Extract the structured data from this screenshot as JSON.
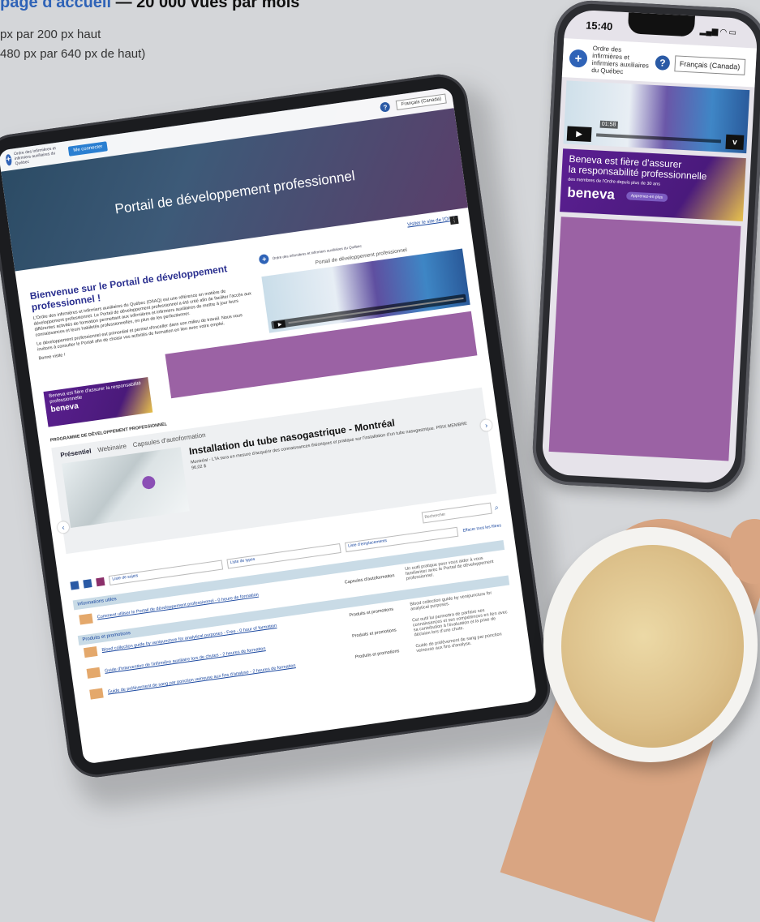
{
  "headline": {
    "part1": "page d'accueil",
    "part2": " — 20 000 vues par mois"
  },
  "specs": [
    "px par 200 px haut",
    "480 px par 640 px de haut)"
  ],
  "tablet": {
    "login_button": "Me connecter",
    "logo_text": "Ordre des infirmières et infirmiers auxiliaires du Québec",
    "language": "Français (Canada)",
    "hero_title": "Portail de développement professionnel",
    "site_link": "Visiter le site de l'OIIAQ",
    "welcome_title": "Bienvenue sur le Portail de développement professionnel !",
    "welcome_p1": "L'Ordre des infirmières et infirmiers auxiliaires du Québec (OIIAQ) est une référence en matière de développement professionnel. Le Portail de développement professionnel a été créé afin de faciliter l'accès aux différentes activités de formation permettant aux infirmières et infirmiers auxiliaires de mettre à jour leurs connaissances et leurs habiletés professionnelles, en plus de les perfectionner.",
    "welcome_p2": "Le développement professionnel est primordial et permet d'exceller dans son milieu de travail. Nous vous invitons à consulter le Portail afin de choisir vos activités de formation en lien avec votre emploi.",
    "welcome_p3": "Bonne visite !",
    "portal_sub": "Portail de développement professionnel",
    "beneva_text": "Beneva est fière d'assurer la responsabilité professionnelle",
    "beneva_sub": "des membres de l'Ordre depuis plus de 30 ans",
    "beneva_brand": "beneva",
    "program_title": "PROGRAMME DE DÉVELOPPEMENT PROFESSIONNEL",
    "tabs": [
      "Présentiel",
      "Webinaire",
      "Capsules d'autoformation"
    ],
    "card_title": "Installation du tube nasogastrique - Montréal",
    "card_desc": "Montréal - L'IA sera en mesure d'acquérir des connaissances théoriques et pratique sur l'installation d'un tube nasogastrique. PRIX MEMBRE 96,02 $",
    "search_placeholder": "Rechercher",
    "filters": [
      "Liste de sujets",
      "Liste de types",
      "Liste d'emplacements"
    ],
    "clear_filters": "Effacer tous les filtres",
    "groups": [
      {
        "label": "Informations utiles",
        "items": [
          {
            "title": "Comment utiliser le Portail de développement professionnel - 0 heure de formation",
            "kind": "Capsules d'autoformation",
            "desc": "Un outil pratique pour vous aider à vous familiariser avec le Portail de développement professionnel."
          }
        ]
      },
      {
        "label": "Produits et promotions",
        "items": [
          {
            "title": "Blood collection guide by venipuncture for analytical purposes - Free - 0 hour of formation",
            "kind": "Produits et promotions",
            "desc": "Blood collection guide by venipuncture for analytical purposes."
          },
          {
            "title": "Guide d'intervention de l'infirmière auxiliaire lors de chutes - 2 heures de formation",
            "kind": "Produits et promotions",
            "desc": "Cet outil lui permettra de parfaire ses connaissances et ses compétences en lien avec sa contribution à l'évaluation et la prise de décision lors d'une chute."
          },
          {
            "title": "Guide de prélèvement de sang par ponction veineuse aux fins d'analyse - 2 heures de formation",
            "kind": "Produits et promotions",
            "desc": "Guide de prélèvement de sang par ponction veineuse aux fins d'analyse."
          }
        ]
      }
    ]
  },
  "phone": {
    "time": "15:40",
    "logo_text": "Ordre des infirmières et infirmiers auxiliaires du Québec",
    "language": "Français (Canada)",
    "video_time": "01:58",
    "beneva_line1": "Beneva est fière d'assurer",
    "beneva_line2": "la responsabilité professionnelle",
    "beneva_sub": "des membres de l'Ordre depuis plus de 30 ans",
    "beneva_brand": "beneva",
    "beneva_cta": "Apprenez-en plus"
  },
  "colors": {
    "accent": "#2f63b7",
    "ad_purple": "#9b62a4",
    "beneva_purple": "#5b1f92"
  }
}
